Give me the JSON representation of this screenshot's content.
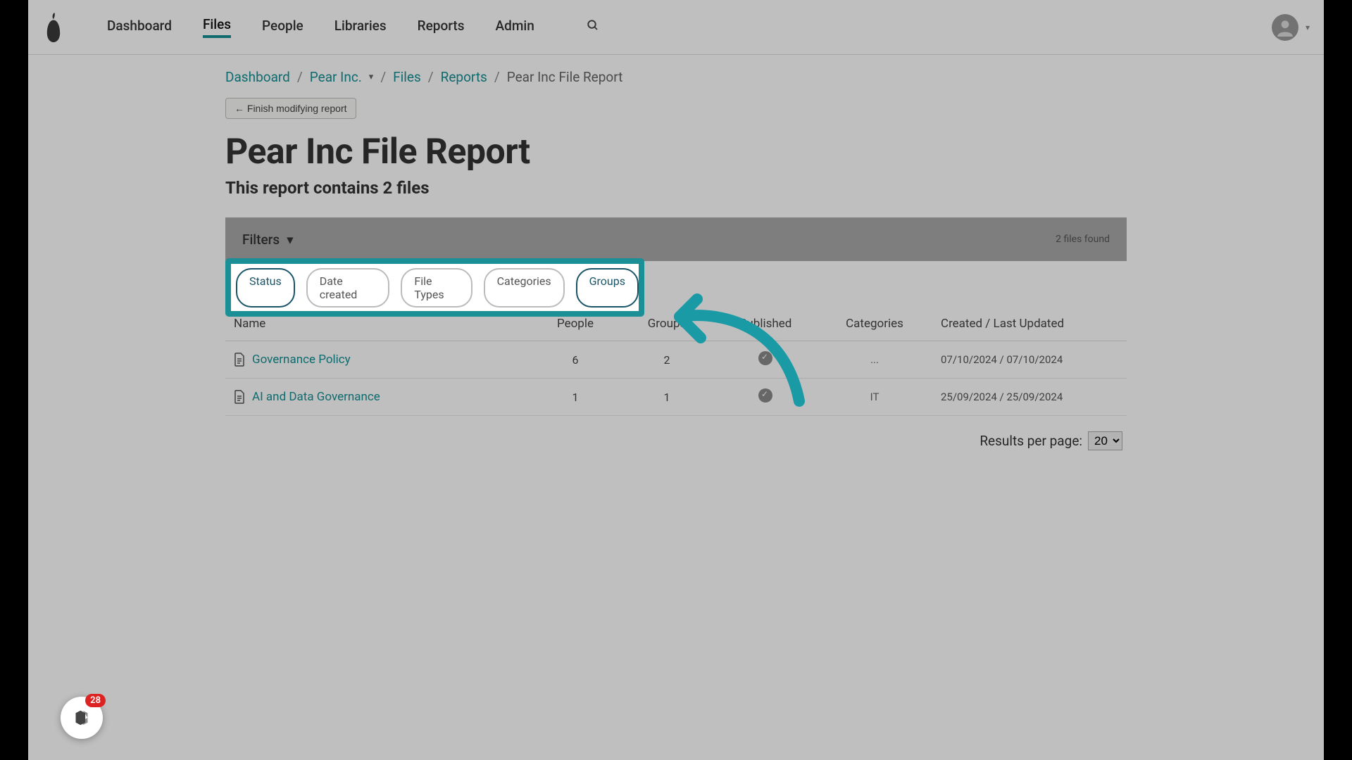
{
  "nav": {
    "items": [
      "Dashboard",
      "Files",
      "People",
      "Libraries",
      "Reports",
      "Admin"
    ],
    "active_index": 1
  },
  "breadcrumb": {
    "items": [
      "Dashboard",
      "Pear Inc.",
      "Files",
      "Reports"
    ],
    "current": "Pear Inc File Report"
  },
  "finish_button": "← Finish modifying report",
  "title": "Pear Inc File Report",
  "subtitle": "This report contains 2 files",
  "filters": {
    "label": "Filters",
    "found_text": "2 files found",
    "chips": [
      {
        "label": "Status",
        "active": true
      },
      {
        "label": "Date created",
        "active": false
      },
      {
        "label": "File Types",
        "active": false
      },
      {
        "label": "Categories",
        "active": false
      },
      {
        "label": "Groups",
        "active": true
      }
    ]
  },
  "table": {
    "columns": [
      "Name",
      "People",
      "Groups",
      "Published",
      "Categories",
      "Created / Last Updated"
    ],
    "rows": [
      {
        "name": "Governance Policy",
        "people": "6",
        "groups": "2",
        "published": true,
        "categories": "...",
        "dates": "07/10/2024 / 07/10/2024"
      },
      {
        "name": "AI and Data Governance",
        "people": "1",
        "groups": "1",
        "published": true,
        "categories": "IT",
        "dates": "25/09/2024 / 25/09/2024"
      }
    ]
  },
  "pager": {
    "label": "Results per page:",
    "value": "20"
  },
  "widget_badge": "28"
}
